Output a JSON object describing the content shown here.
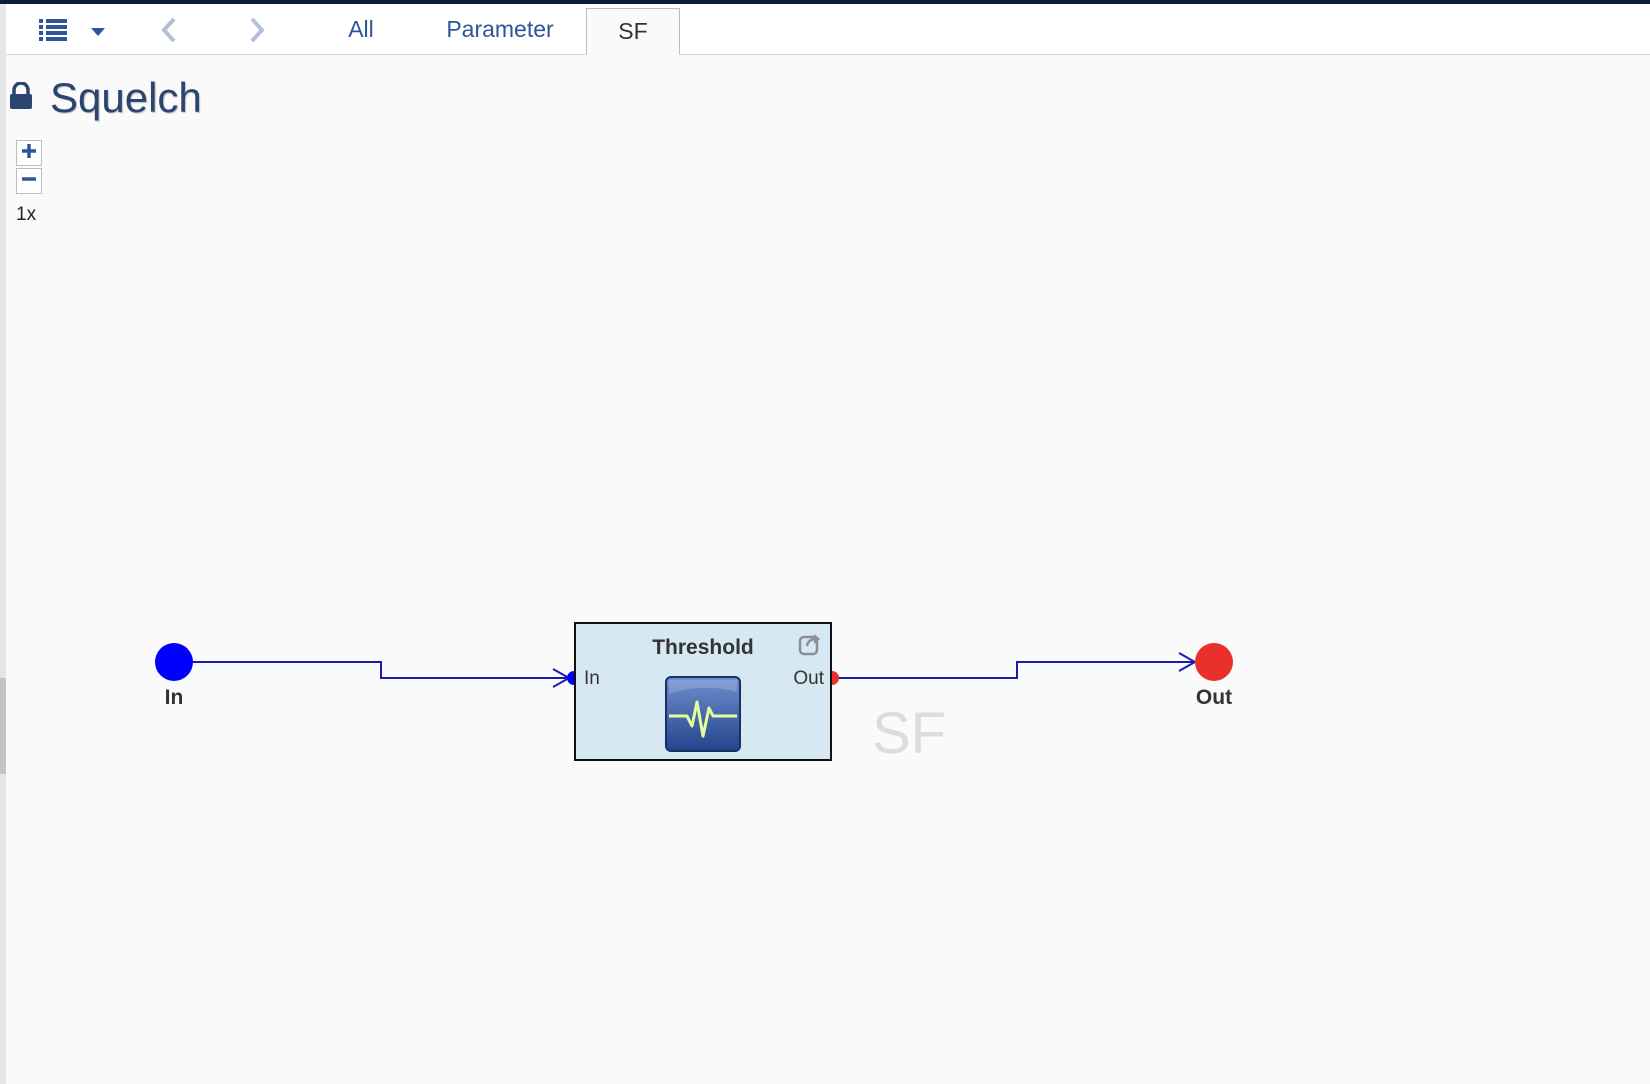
{
  "tabs": [
    {
      "label": "All"
    },
    {
      "label": "Parameter"
    },
    {
      "label": "SF",
      "active": true
    }
  ],
  "header": {
    "title": "Squelch",
    "locked": true
  },
  "zoom": {
    "level": "1x"
  },
  "diagram": {
    "input_node": {
      "label": "In",
      "color": "#0000ff"
    },
    "output_node": {
      "label": "Out",
      "color": "#e8312a"
    },
    "block": {
      "title": "Threshold",
      "input_port": "In",
      "output_port": "Out",
      "fill": "#d6e8f1"
    },
    "subsystem_label": "SF",
    "wire_color": "#1b1baf"
  },
  "icons": {
    "menu": "list-menu-icon",
    "dropdown": "caret-down-icon",
    "back": "chevron-left-icon",
    "forward": "chevron-right-icon",
    "lock": "lock-icon",
    "zoom_in": "plus-icon",
    "zoom_out": "minus-icon",
    "open": "open-external-icon",
    "waveform": "waveform-icon"
  }
}
